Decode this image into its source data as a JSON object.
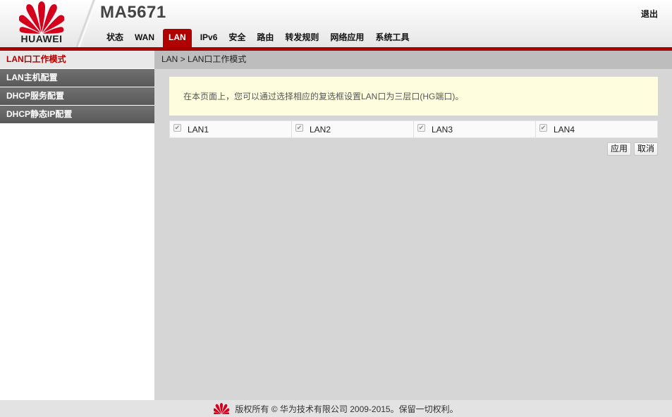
{
  "header": {
    "brand": "HUAWEI",
    "model": "MA5671",
    "logout_label": "退出",
    "nav": [
      "状态",
      "WAN",
      "LAN",
      "IPv6",
      "安全",
      "路由",
      "转发规则",
      "网络应用",
      "系统工具"
    ],
    "active_nav": "LAN"
  },
  "sidebar": {
    "items": [
      "LAN口工作模式",
      "LAN主机配置",
      "DHCP服务配置",
      "DHCP静态IP配置"
    ],
    "active": "LAN口工作模式"
  },
  "main": {
    "breadcrumb": "LAN > LAN口工作模式",
    "notice": "在本页面上，您可以通过选择相应的复选框设置LAN口为三层口(HG端口)。",
    "ports": [
      {
        "label": "LAN1",
        "checked": true
      },
      {
        "label": "LAN2",
        "checked": true
      },
      {
        "label": "LAN3",
        "checked": true
      },
      {
        "label": "LAN4",
        "checked": true
      }
    ],
    "apply_label": "应用",
    "cancel_label": "取消"
  },
  "footer": {
    "copyright": "版权所有 © 华为技术有限公司 2009-2015。保留一切权利。"
  },
  "colors": {
    "brand_red": "#b00000",
    "sidebar_dark": "#5f5f5f",
    "notice_bg": "#fefedf",
    "content_bg": "#d6d6d6"
  },
  "icons": {
    "logo": "huawei-flower-logo",
    "checkbox": "checkbox-checked-icon"
  }
}
